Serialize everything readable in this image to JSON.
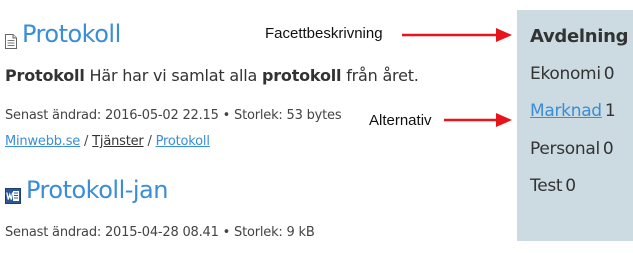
{
  "results": [
    {
      "icon": "document-icon",
      "title": "Protokoll",
      "snippet": {
        "part1": "Protokoll",
        "part2": " Här har vi samlat alla ",
        "part3": "protokoll",
        "part4": " från året."
      },
      "meta": "Senast ändrad: 2016-05-02 22.15 • Storlek: 53 bytes",
      "breadcrumbs": [
        "Minwebb.se",
        "Tjänster",
        "Protokoll"
      ],
      "breadcrumb_sep": "/"
    },
    {
      "icon": "word-document-icon",
      "title": "Protokoll-jan",
      "meta": "Senast ändrad: 2015-04-28 08.41 • Storlek: 9 kB"
    }
  ],
  "annotations": {
    "facet_description": "Facettbeskrivning",
    "alternative": "Alternativ"
  },
  "facet": {
    "title": "Avdelning",
    "options": [
      {
        "label": "Ekonomi",
        "count": "0",
        "link": false
      },
      {
        "label": "Marknad",
        "count": "1",
        "link": true
      },
      {
        "label": "Personal",
        "count": "0",
        "link": false
      },
      {
        "label": "Test",
        "count": "0",
        "link": false
      }
    ]
  },
  "colors": {
    "link": "#3a8dd6",
    "facet_background": "#cbdbe1",
    "arrow": "#e8141b"
  }
}
